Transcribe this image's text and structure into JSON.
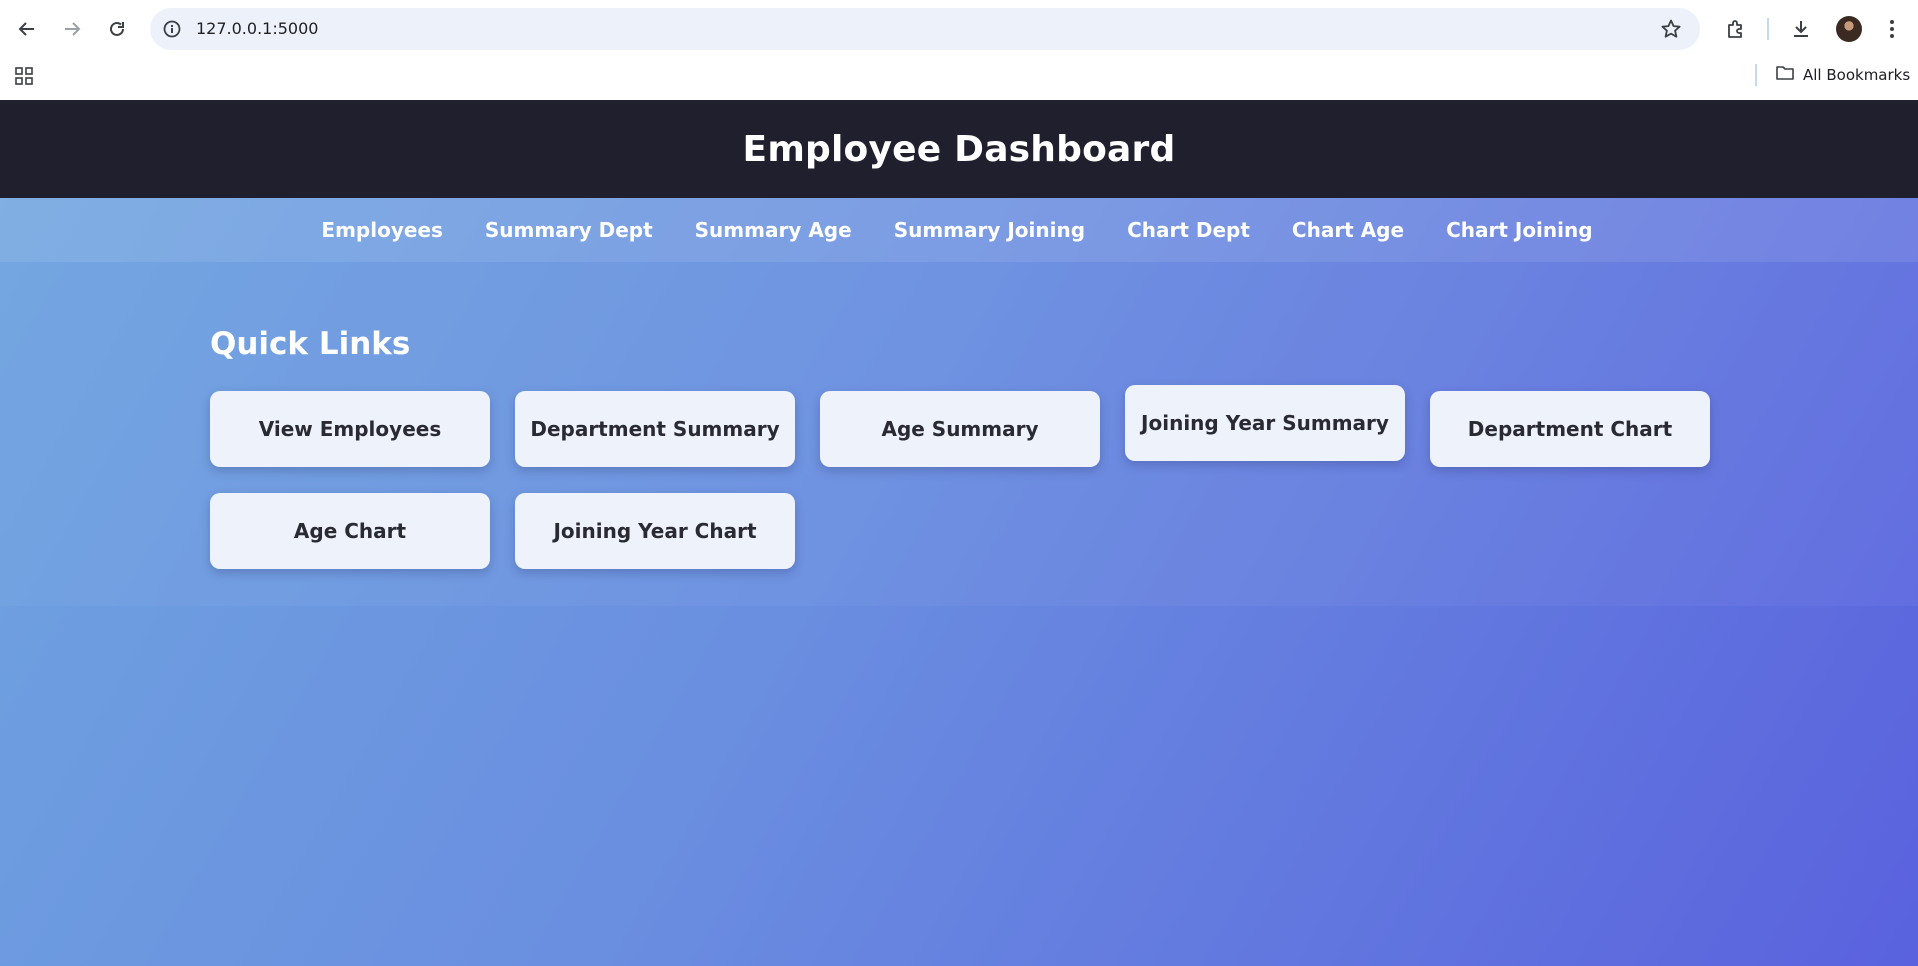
{
  "browser": {
    "url": "127.0.0.1:5000",
    "bookmarks_folder": "All Bookmarks",
    "icons": [
      "back-icon",
      "forward-icon",
      "reload-icon",
      "site-info-icon",
      "bookmark-star-icon",
      "extensions-icon",
      "download-icon",
      "profile-avatar",
      "menu-icon",
      "apps-icon",
      "folder-icon"
    ]
  },
  "header": {
    "title": "Employee Dashboard"
  },
  "nav": {
    "items": [
      "Employees",
      "Summary Dept",
      "Summary Age",
      "Summary Joining",
      "Chart Dept",
      "Chart Age",
      "Chart Joining"
    ]
  },
  "quick_links": {
    "title": "Quick Links",
    "items": [
      "View Employees",
      "Department Summary",
      "Age Summary",
      "Joining Year Summary",
      "Department Chart",
      "Age Chart",
      "Joining Year Chart"
    ]
  },
  "colors": {
    "header_bg": "#1f1f2e",
    "gradient_start": "#6fa5e0",
    "gradient_end": "#5a62de",
    "card_bg": "#eef2fb"
  }
}
